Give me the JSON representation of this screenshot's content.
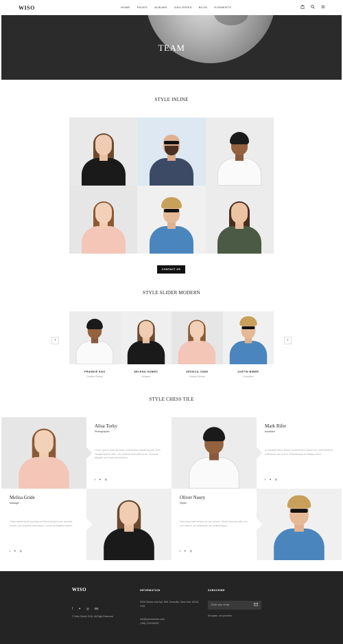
{
  "header": {
    "logo": "WISO",
    "nav": [
      "HOME",
      "PAGES",
      "ALBUMS",
      "GALLERIES",
      "BLOG",
      "ELEMENTS"
    ],
    "icons": [
      "bag-icon",
      "search-icon",
      "menu-icon"
    ]
  },
  "hero": {
    "title": "TEAM"
  },
  "sections": {
    "inline": "STYLE INLINE",
    "slider": "STYLE SLIDER MODERN",
    "chess": "STYLE CHESS TILE"
  },
  "contact_button": "CONTACT US",
  "slider": {
    "members": [
      {
        "name": "FRANKIE KAO",
        "role": "Creative Director"
      },
      {
        "name": "SELENA GOMEZ",
        "role": "Designer"
      },
      {
        "name": "JESSICA JUNG",
        "role": "Creative Director"
      },
      {
        "name": "JUSTIN BIBER",
        "role": "Consultant"
      }
    ]
  },
  "chess": {
    "alisa": {
      "name": "Alisa Torky",
      "role": "Photographer",
      "desc": "Lorem ipsum dolor sit amet, consectetur adipiscing elit. Duis volutpat ipsum odio, nec pulvinar erat efficitur ac. Vivamus aliquam sed risus sed pretium."
    },
    "mark": {
      "name": "Mark Rifer",
      "role": "Assistant",
      "desc": "In volutpat tellus. Etiam condimentum ipsum nec velit tincidunt sollicitudin nec id est. Pellentesque at tristique enim."
    },
    "melisa": {
      "name": "Melisa Gride",
      "role": "Manager",
      "desc": "Class aptent taciti sociosqu ad litora torquent per conubia nostra, per inceptos himenaeos. Donec at fringilla mauris."
    },
    "oliver": {
      "name": "Oliver Naory",
      "role": "Stylist",
      "desc": "Nam imperdiet tempor ex non dictum. Morbi rhoncus odio non orci viverra, ac sollicitudin orci pellentesque."
    },
    "social": "f ✦ ◎"
  },
  "footer": {
    "logo": "WISO",
    "copyright": "© Wiso Studio 2018. All Right Reserved",
    "info_heading": "INFORMATION",
    "address": "2005 Stokes Isle Apt. 896, Venaville, New York 10010, USA",
    "email": "info@yourdomain.com",
    "phone": "(+68) 120034509",
    "subscribe_heading": "SUBSCRIBE",
    "subscribe_placeholder": "Enter your email",
    "no_spam": "No spam, we promise"
  }
}
